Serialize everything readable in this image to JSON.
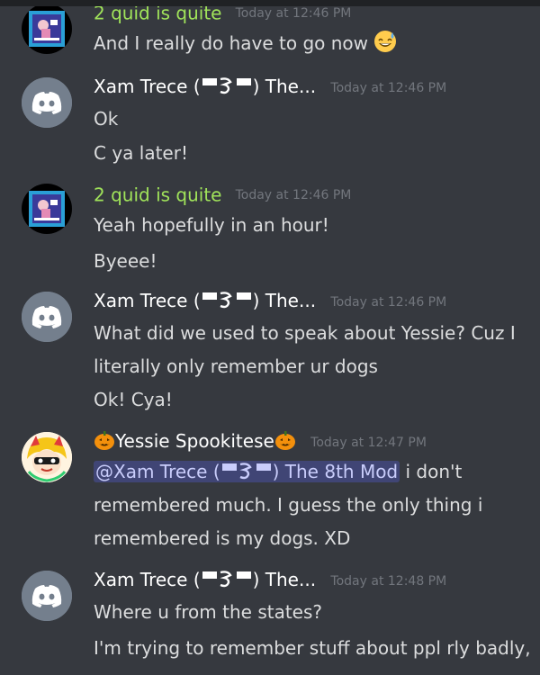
{
  "messages": [
    {
      "author": "2 quid is quite",
      "timestamp": "Today at 12:46 PM",
      "lines": [
        "And I really do have to go now"
      ]
    },
    {
      "author_prefix": "Xam Trece (",
      "author_suffix": ") The...",
      "timestamp": "Today at 12:46 PM",
      "lines": [
        "Ok",
        "C ya later!"
      ]
    },
    {
      "author": "2 quid is quite",
      "timestamp": "Today at 12:46 PM",
      "lines": [
        "Yeah hopefully in an hour!",
        "Byeee!"
      ]
    },
    {
      "author_prefix": "Xam Trece (",
      "author_suffix": ") The...",
      "timestamp": "Today at 12:46 PM",
      "lines": [
        "What did we used to speak about Yessie? Cuz I",
        "literally only remember ur dogs",
        "Ok! Cya!"
      ]
    },
    {
      "author": "Yessie Spookitese",
      "timestamp": "Today at 12:47 PM",
      "mention_prefix": "@Xam Trece (",
      "mention_suffix": ") The 8th Mod",
      "lines": [
        " i don't",
        "remembered much. I guess the only thing i",
        "remembered is my dogs. XD"
      ]
    },
    {
      "author_prefix": "Xam Trece (",
      "author_suffix": ") The...",
      "timestamp": "Today at 12:48 PM",
      "lines": [
        "Where u from the states?",
        "I'm trying to remember stuff about ppl rly badly,"
      ]
    }
  ],
  "colors": {
    "background": "#36393f",
    "text": "#dcddde",
    "author_green": "#a0e35a",
    "timestamp": "#72767d",
    "mention_bg": "rgba(88,101,242,0.3)",
    "discord_avatar": "#747f8d"
  }
}
